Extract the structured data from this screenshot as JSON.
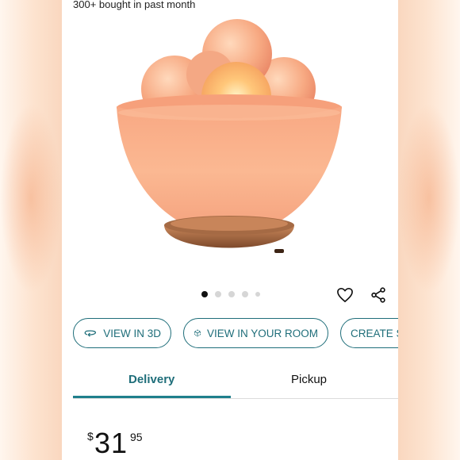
{
  "listing": {
    "bought_text": "300+ bought in past month"
  },
  "carousel": {
    "dot_count": 5,
    "active_index": 0
  },
  "actions": {
    "view_3d": "VIEW IN 3D",
    "view_room": "VIEW IN YOUR ROOM",
    "create": "CREATE S"
  },
  "tabs": {
    "delivery": "Delivery",
    "pickup": "Pickup",
    "selected": "Delivery"
  },
  "price": {
    "symbol": "$",
    "whole": "31",
    "fraction": "95"
  },
  "colors": {
    "accent": "#1f6e7a",
    "tab_underline": "#1f7f8c"
  },
  "icons": {
    "favorite": "heart-icon",
    "share": "share-icon",
    "view_3d": "rotate-3d-icon",
    "view_room": "cube-ar-icon"
  }
}
